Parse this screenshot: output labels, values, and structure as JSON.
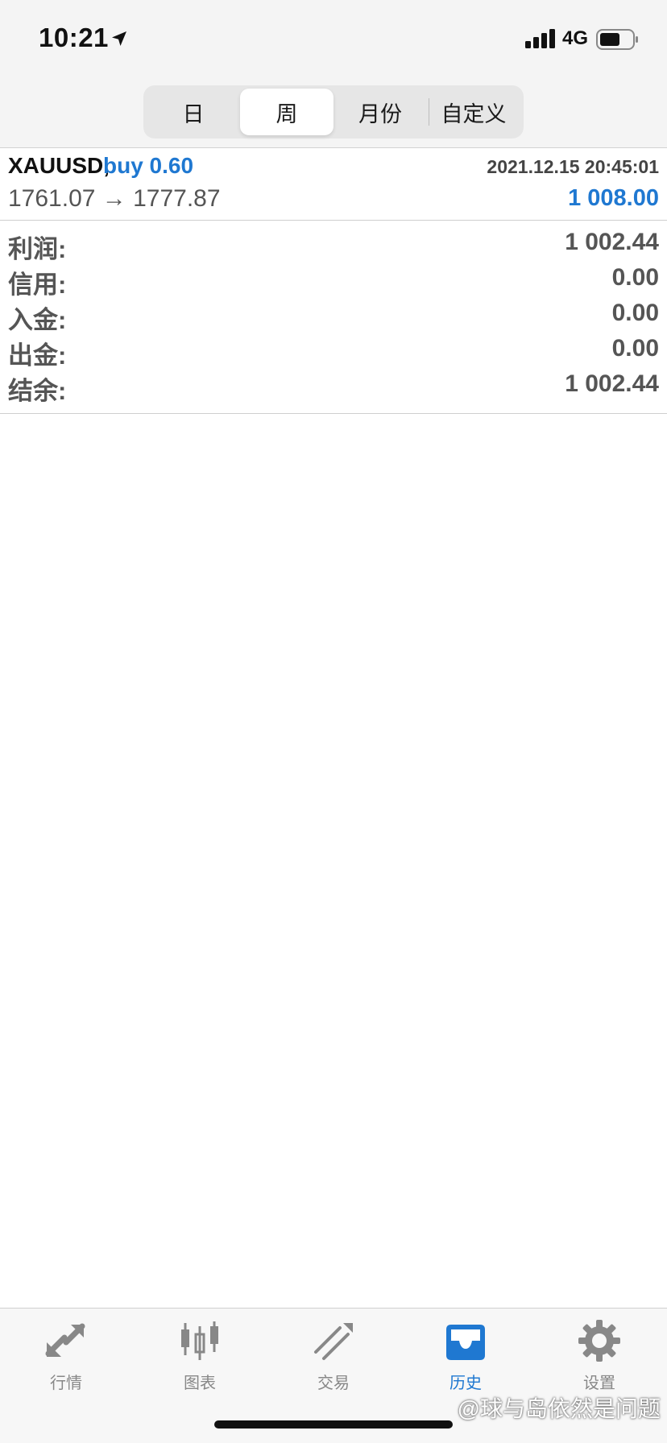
{
  "status_bar": {
    "time": "10:21",
    "network": "4G"
  },
  "period_tabs": [
    "日",
    "周",
    "月份",
    "自定义"
  ],
  "selected_period": "周",
  "trade": {
    "symbol": "XAUUSD,",
    "side": "buy 0.60",
    "time": "2021.12.15 20:45:01",
    "prices": "1761.07 → 1777.87",
    "profit": "1 008.00"
  },
  "summary": [
    {
      "label": "利润:",
      "value": "1 002.44"
    },
    {
      "label": "信用:",
      "value": "0.00"
    },
    {
      "label": "入金:",
      "value": "0.00"
    },
    {
      "label": "出金:",
      "value": "0.00"
    },
    {
      "label": "结余:",
      "value": "1 002.44"
    }
  ],
  "tabbar": [
    {
      "label": "行情",
      "icon": "quotes-icon"
    },
    {
      "label": "图表",
      "icon": "chart-icon"
    },
    {
      "label": "交易",
      "icon": "trade-icon"
    },
    {
      "label": "历史",
      "icon": "history-icon"
    },
    {
      "label": "设置",
      "icon": "settings-icon"
    }
  ],
  "active_tab": "历史",
  "watermark": "@球与岛依然是问题",
  "colors": {
    "accent": "#1f78d1",
    "label": "#555555",
    "inactive_tab": "#888888"
  }
}
